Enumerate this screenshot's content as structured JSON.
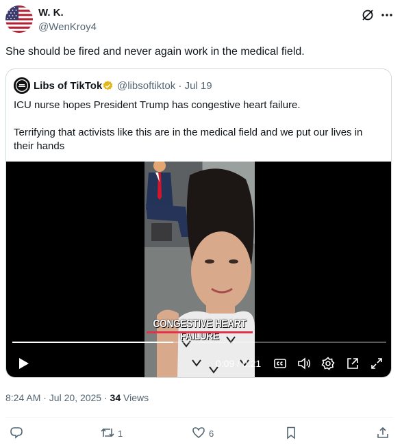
{
  "author": {
    "name": "W. K.",
    "handle": "@WenKroy4",
    "avatar_icon": "us-flag-avatar"
  },
  "header_icons": [
    "grok-icon",
    "more-icon"
  ],
  "tweet_text": "She should be fired and never again work in the medical field.",
  "quote": {
    "name": "Libs of TikTok",
    "badge_icon": "verified-gold-badge-icon",
    "handle_date": "@libsoftiktok · Jul 19",
    "text": "ICU nurse hopes President Trump has congestive heart failure.\n\nTerrifying that activists like this are in the medical field and we put our lives in their hands",
    "avatar_icon": "libs-of-tiktok-avatar"
  },
  "video": {
    "caption": "CONGESTIVE HEART FAILURE",
    "time": "0:09 / 0:21",
    "progress": 0.43,
    "controls": [
      "play-icon",
      "closed-captions-icon",
      "volume-icon",
      "settings-icon",
      "pop-out-icon",
      "fullscreen-icon"
    ]
  },
  "meta": {
    "timestamp": "8:24 AM · Jul 20, 2025 · ",
    "views_count": "34",
    "views_label": " Views"
  },
  "actions": {
    "reply_count": "",
    "repost_count": "1",
    "like_count": "6",
    "icons": [
      "reply-icon",
      "repost-icon",
      "like-icon",
      "bookmark-icon",
      "share-icon"
    ]
  },
  "colors": {
    "text": "#0f1419",
    "secondary": "#536471",
    "border": "#cfd9de",
    "caption_bar": "#e0324b",
    "verified": "#e2b719"
  }
}
